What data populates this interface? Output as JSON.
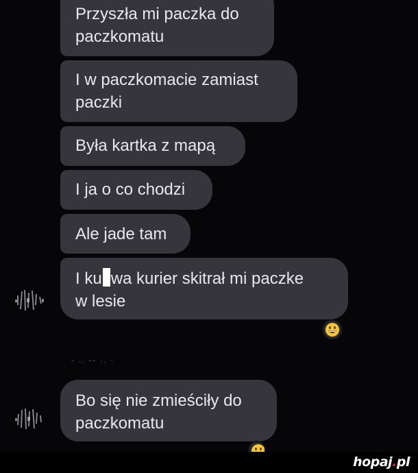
{
  "messages": [
    {
      "lines": [
        "Przyszła mi paczka do",
        "paczkomatu"
      ]
    },
    {
      "lines": [
        "I w paczkomacie zamiast",
        "paczki"
      ]
    },
    {
      "lines": [
        "Była kartka z mapą"
      ]
    },
    {
      "lines": [
        "I ja o co chodzi"
      ]
    },
    {
      "lines": [
        "Ale jade tam"
      ]
    },
    {
      "line1_before": "I ku",
      "line1_after": "wa kurier skitrał mi paczke",
      "line2": "w lesie"
    },
    {
      "lines": [
        "Bo się nie zmieściły do",
        "paczkomatu"
      ]
    }
  ],
  "sender_name_blurred": "- .. -- .. ·",
  "reactions": [
    "grinning-face-emoji",
    "grinning-face-emoji"
  ],
  "watermark": {
    "name": "hopaj",
    "dot": ".",
    "tld": "pl"
  },
  "colors": {
    "background": "#060608",
    "bubble": "#36353b",
    "text": "#e9e8ec",
    "watermark_accent": "#e22b2b"
  }
}
